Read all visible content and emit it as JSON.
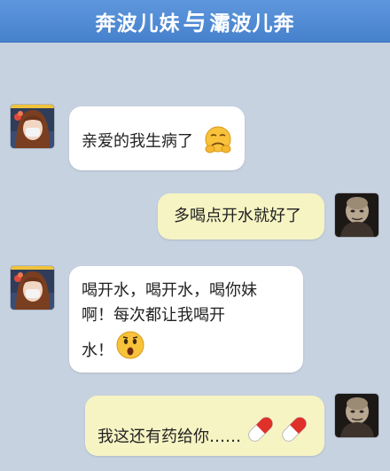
{
  "header": {
    "name_left": "奔波儿妹",
    "connector": "与",
    "name_right": "灞波儿奔"
  },
  "messages": [
    {
      "side": "left",
      "text": "亲爱的我生病了",
      "emoji": "sick-face-emoji"
    },
    {
      "side": "right",
      "text": "多喝点开水就好了"
    },
    {
      "side": "left",
      "lines": [
        "喝开水，喝开水，喝你妹",
        "啊！每次都让我喝开",
        "水！"
      ],
      "emoji": "surprised-face-emoji"
    },
    {
      "side": "right",
      "text": "我这还有药给你……",
      "emoji": "pill-capsules"
    }
  ],
  "colors": {
    "background": "#c7d2e1",
    "header": "#4f89d3",
    "left_bubble": "#ffffff",
    "right_bubble": "#f6f4c3"
  }
}
